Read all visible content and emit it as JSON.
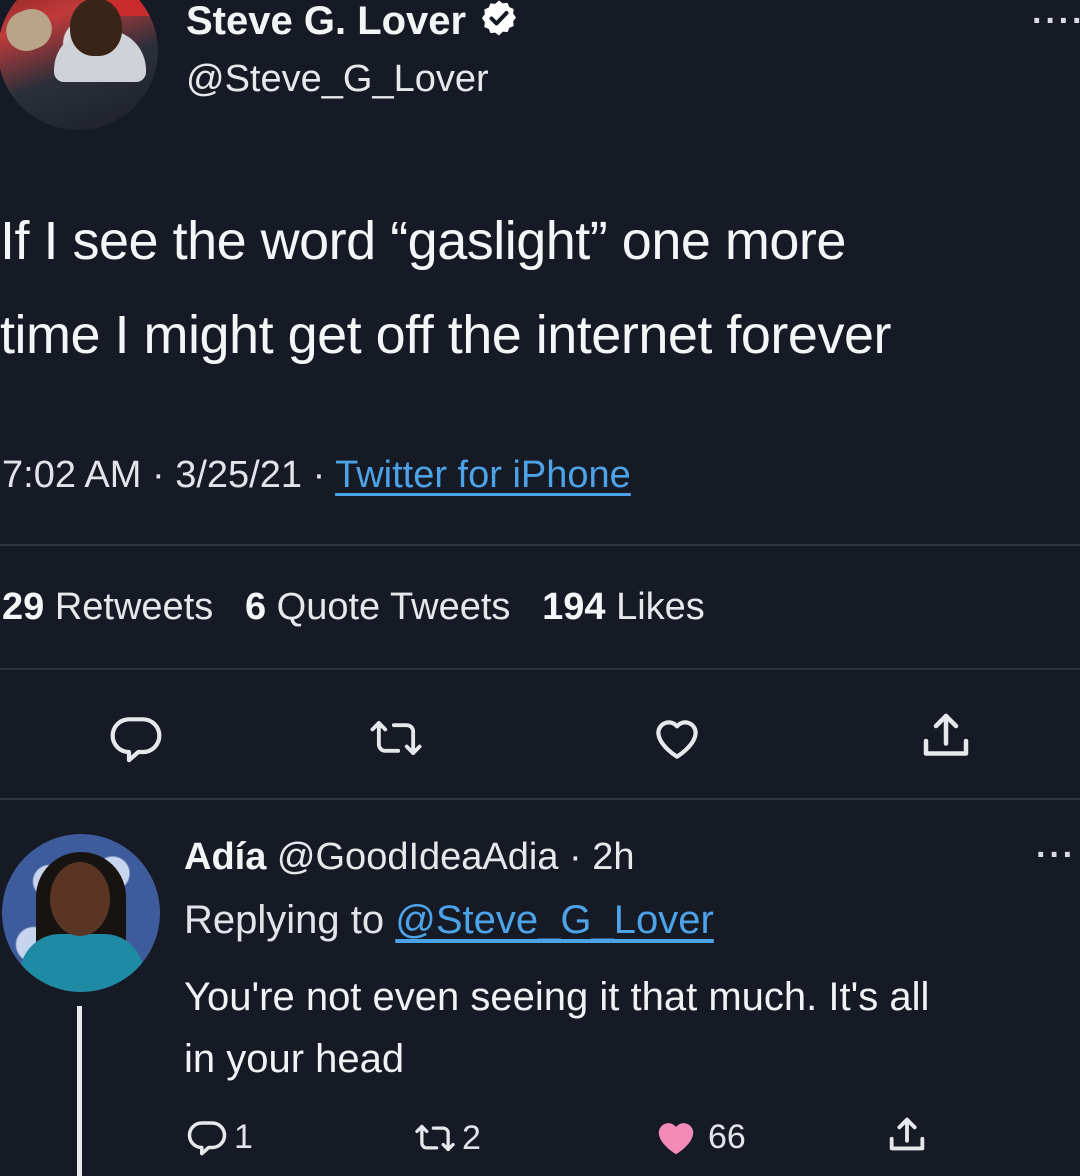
{
  "tweet": {
    "author_name": "Steve G. Lover",
    "author_handle": "@Steve_G_Lover",
    "more_label": "····",
    "text_line1": "If I see the word “gaslight” one more",
    "text_line2": "time I might get off the internet forever",
    "time": "7:02 AM",
    "sep1": "·",
    "date": "3/25/21",
    "sep2": "·",
    "source": "Twitter for iPhone",
    "retweets_count": "29",
    "retweets_label": "Retweets",
    "quotes_count": "6",
    "quotes_label": "Quote Tweets",
    "likes_count": "194",
    "likes_label": "Likes"
  },
  "reply": {
    "author_name": "Adía",
    "author_handle": "@GoodIdeaAdia",
    "sep": "·",
    "age": "2h",
    "more_label": "···",
    "replying_label": "Replying to",
    "replying_handle": "@Steve_G_Lover",
    "text_line1": "You're not even seeing it that much. It's all",
    "text_line2": "in your head",
    "reply_count": "1",
    "retweet_count": "2",
    "like_count": "66"
  },
  "colors": {
    "background": "#161a24",
    "link": "#4da3e8",
    "like_filled": "#f28bb5",
    "verified": "#ffffff"
  },
  "icons": [
    "verified-badge-icon",
    "more-icon",
    "reply-icon",
    "retweet-icon",
    "like-icon",
    "share-icon"
  ]
}
